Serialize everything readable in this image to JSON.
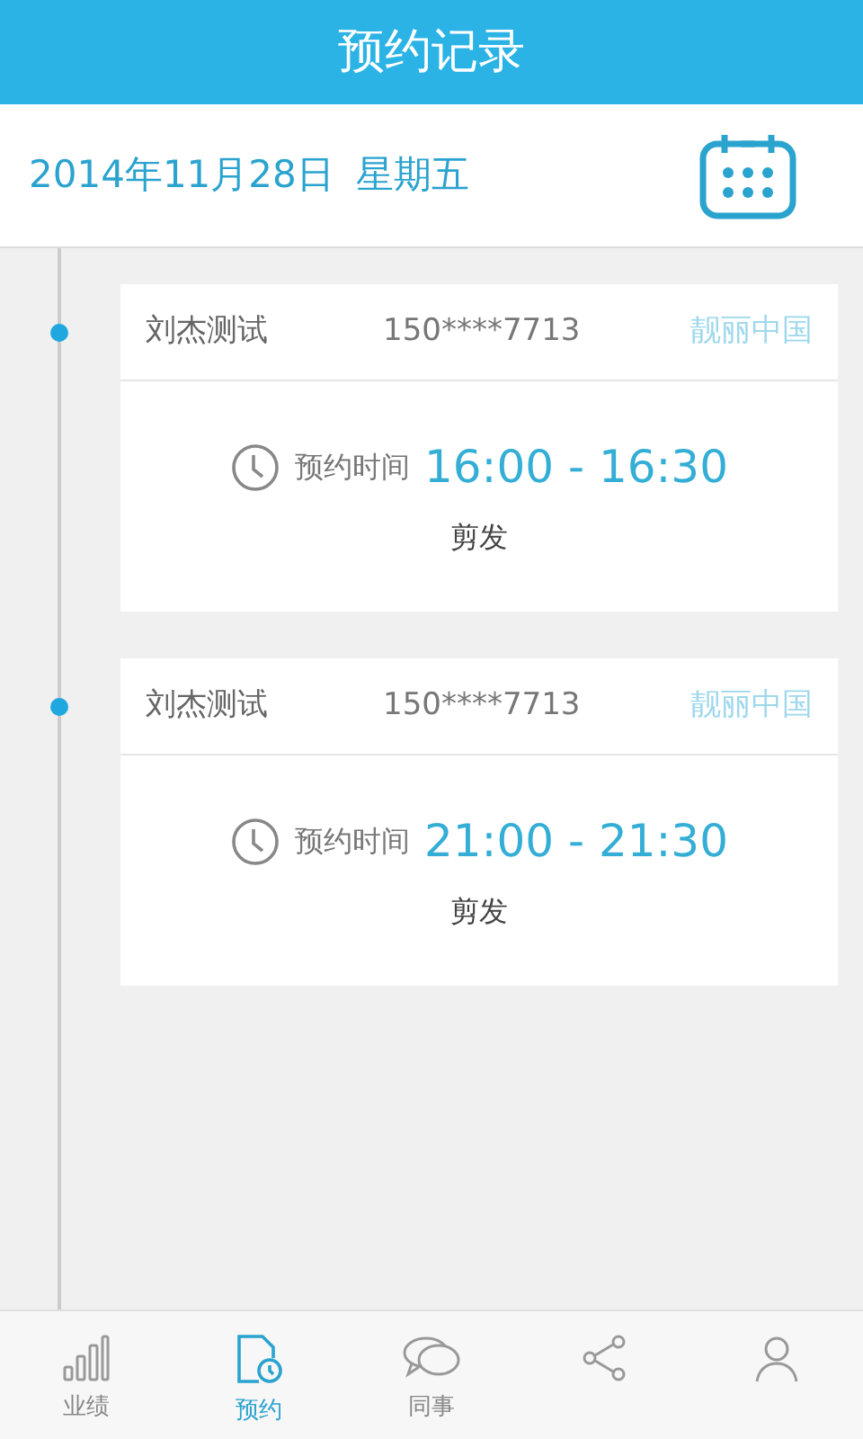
{
  "header": {
    "title": "预约记录"
  },
  "date_bar": {
    "date": "2014年11月28日",
    "weekday": "星期五"
  },
  "appointments": [
    {
      "customer": "刘杰测试",
      "phone": "150****7713",
      "store": "靓丽中国",
      "time_label": "预约时间",
      "time": "16:00 - 16:30",
      "service": "剪发"
    },
    {
      "customer": "刘杰测试",
      "phone": "150****7713",
      "store": "靓丽中国",
      "time_label": "预约时间",
      "time": "21:00 - 21:30",
      "service": "剪发"
    }
  ],
  "tabs": [
    {
      "kind": "chart",
      "label": "业绩",
      "selected": false
    },
    {
      "kind": "booking",
      "label": "预约",
      "selected": true
    },
    {
      "kind": "chat",
      "label": "同事",
      "selected": false
    },
    {
      "kind": "share",
      "selected": false
    },
    {
      "kind": "user",
      "selected": false
    }
  ]
}
